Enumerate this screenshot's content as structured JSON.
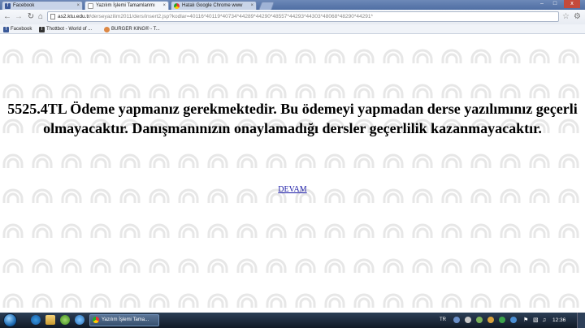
{
  "browser": {
    "tabs": [
      {
        "title": "Facebook",
        "favicon": "facebook-icon"
      },
      {
        "title": "Yazılım İşlemi Tamamlanmı",
        "favicon": "ktu-icon"
      },
      {
        "title": "Hatalı Google Chrome www",
        "favicon": "chrome-icon"
      }
    ],
    "url": {
      "host": "as2.ktu.edu.tr",
      "path": "/derseyazilim2011/ders/insert2.jsp?kodlar=40116*40119*40734*44289*44290*48557*44293*44303*48068*48290*44291*"
    },
    "bookmarks": [
      {
        "label": "Facebook",
        "icon": "facebook-icon"
      },
      {
        "label": "Thottbot - World of ...",
        "icon": "thottbot-icon"
      },
      {
        "label": "BURGER KING® - T...",
        "icon": "burgerking-icon"
      }
    ],
    "window_controls": {
      "minimize": "–",
      "maximize": "□",
      "close": "x"
    }
  },
  "page": {
    "message": "5525.4TL Ödeme yapmanız gerekmektedir. Bu ödemeyi yapmadan derse yazılımınız geçerli olmayacaktır. Danışmanınızın onaylamadığı dersler geçerlilik kazanmayacaktır.",
    "link_label": "DEVAM",
    "background_logo": "ktu-watermark-logo",
    "watermark_color": "#e7e7e7"
  },
  "taskbar": {
    "task_label": "Yazılım İşlemi Tama...",
    "lang": "TR",
    "clock": "12:36"
  },
  "colors": {
    "tabstrip": "#4f6ea3",
    "link": "#1a1aa6",
    "taskbar": "#111a26"
  }
}
